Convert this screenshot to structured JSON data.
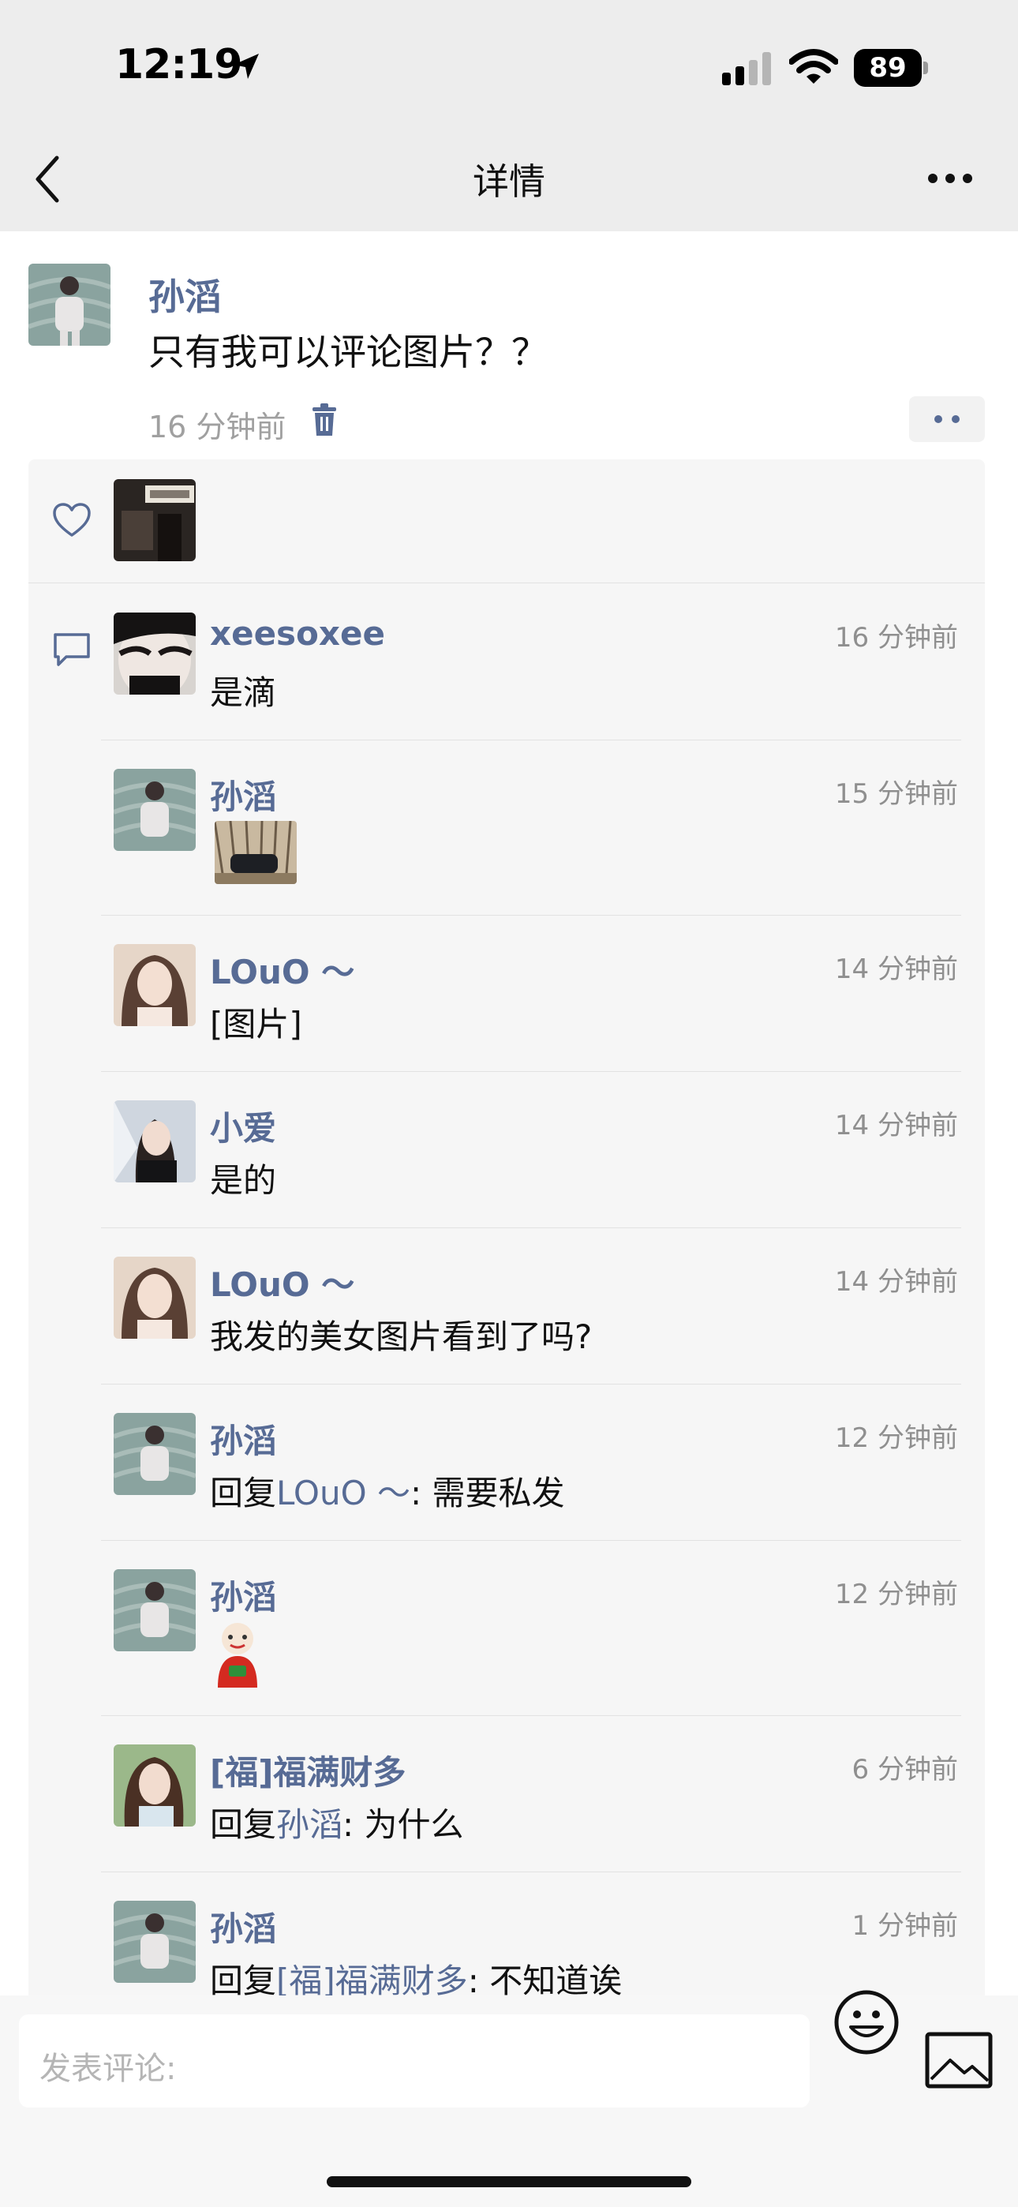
{
  "status_bar": {
    "time": "12:19",
    "battery": "89"
  },
  "nav": {
    "title": "详情"
  },
  "post": {
    "author": "孙滔",
    "text": "只有我可以评论图片？？",
    "time": "16 分钟前"
  },
  "comments": [
    {
      "name": "xeesoxee",
      "time": "16 分钟前",
      "text": "是滴"
    },
    {
      "name": "孙滔",
      "time": "15 分钟前",
      "text": ""
    },
    {
      "name": "LOuO ～",
      "time": "14 分钟前",
      "text": "[图片]"
    },
    {
      "name": "小爱",
      "time": "14 分钟前",
      "text": "是的"
    },
    {
      "name": "LOuO ～",
      "time": "14 分钟前",
      "text": "我发的美女图片看到了吗?"
    },
    {
      "name": "孙滔",
      "time": "12 分钟前",
      "reply_prefix": "回复",
      "reply_to": "LOuO ～",
      "text": ": 需要私发"
    },
    {
      "name": "孙滔",
      "time": "12 分钟前",
      "text": ""
    },
    {
      "name": "[福]福满财多",
      "time": "6 分钟前",
      "reply_prefix": "回复",
      "reply_to": "孙滔",
      "text": ": 为什么"
    },
    {
      "name": "孙滔",
      "time": "1 分钟前",
      "reply_prefix": "回复",
      "reply_to": "[福]福满财多",
      "text": ": 不知道诶"
    }
  ],
  "input": {
    "placeholder": "发表评论:"
  },
  "colors": {
    "link": "#576b95",
    "panel": "#f6f6f6",
    "topbar": "#ededed"
  }
}
